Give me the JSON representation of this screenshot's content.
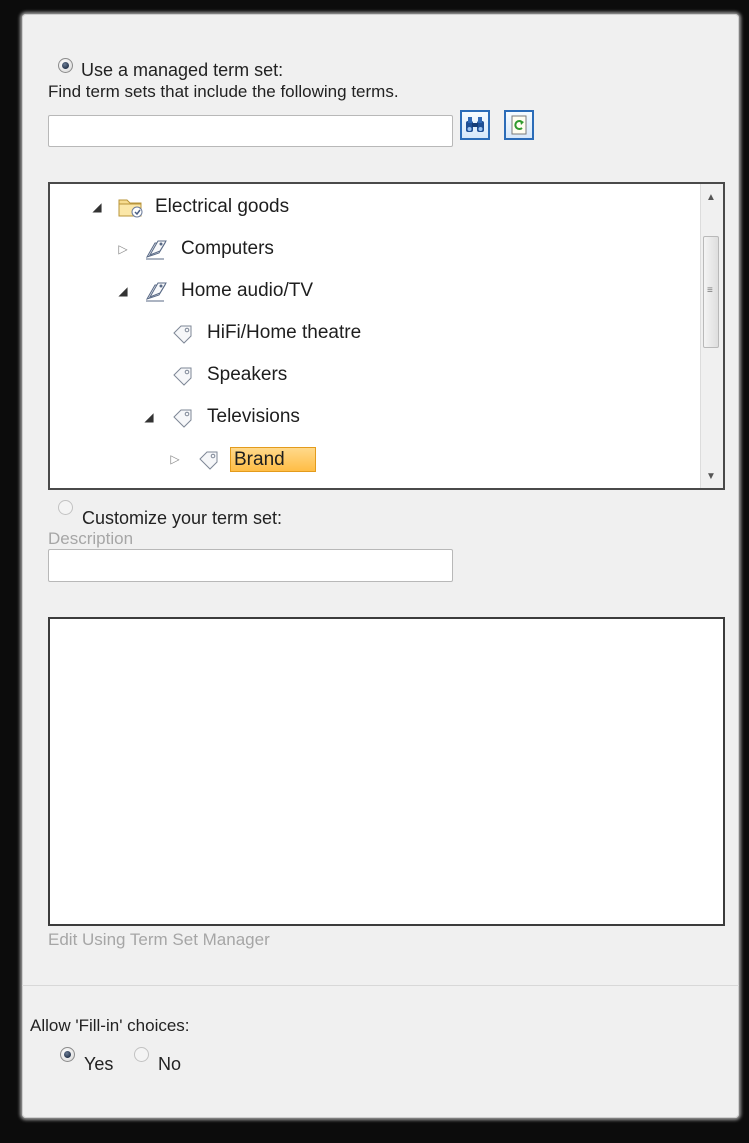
{
  "managed": {
    "radio_label": "Use a managed term set:",
    "find_label": "Find term sets that include the following terms.",
    "search_value": "",
    "find_icon": "binoculars-icon",
    "refresh_icon": "refresh-icon"
  },
  "tree": {
    "nodes": [
      {
        "label": "Electrical goods",
        "expander": "expanded",
        "icon": "term-group-folder-icon"
      },
      {
        "label": "Computers",
        "expander": "collapsed",
        "icon": "term-set-icon"
      },
      {
        "label": "Home audio/TV",
        "expander": "expanded",
        "icon": "term-set-icon"
      },
      {
        "label": "HiFi/Home theatre",
        "expander": "none",
        "icon": "term-tag-icon"
      },
      {
        "label": "Speakers",
        "expander": "none",
        "icon": "term-tag-icon"
      },
      {
        "label": "Televisions",
        "expander": "expanded",
        "icon": "term-tag-icon"
      },
      {
        "label": "Brand",
        "expander": "collapsed",
        "icon": "term-tag-icon",
        "selected": true
      }
    ]
  },
  "custom": {
    "radio_label": "Customize your term set:",
    "description_label": "Description",
    "description_value": "",
    "edit_link": "Edit Using Term Set Manager"
  },
  "fillin": {
    "label": "Allow 'Fill-in' choices:",
    "yes_label": "Yes",
    "no_label": "No",
    "selected": "Yes"
  },
  "colors": {
    "selection": "#ffc04d",
    "accent_blue": "#2b6cb8",
    "panel_bg": "#f0f0f0"
  }
}
